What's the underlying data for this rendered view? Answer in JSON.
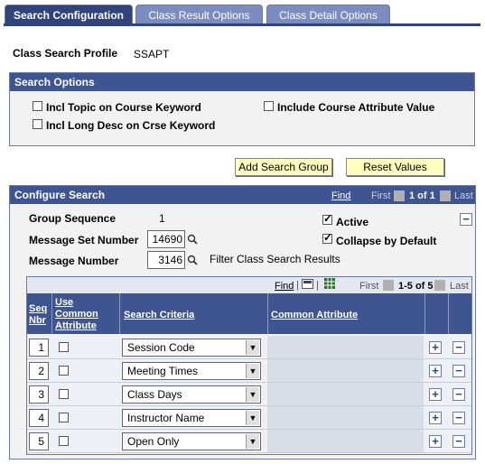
{
  "tabs": [
    {
      "label": "Search Configuration"
    },
    {
      "label": "Class Result Options"
    },
    {
      "label": "Class Detail Options"
    }
  ],
  "profile": {
    "label": "Class Search Profile",
    "value": "SSAPT"
  },
  "search_options": {
    "title": "Search Options",
    "incl_topic": {
      "label": "Incl Topic on Course Keyword",
      "checked": false
    },
    "incl_long_desc": {
      "label": "Incl Long Desc on Crse Keyword",
      "checked": false
    },
    "include_attr": {
      "label": "Include Course Attribute Value",
      "checked": false
    }
  },
  "buttons": {
    "add_search_group": "Add Search Group",
    "reset_values": "Reset Values"
  },
  "configure": {
    "title": "Configure Search",
    "find": "Find",
    "first": "First",
    "range": "1 of 1",
    "last": "Last",
    "group_sequence_label": "Group Sequence",
    "group_sequence_value": "1",
    "message_set_label": "Message Set Number",
    "message_set_value": "14690",
    "message_number_label": "Message Number",
    "message_number_value": "3146",
    "message_text": "Filter Class Search Results",
    "active": {
      "label": "Active",
      "checked": true
    },
    "collapse": {
      "label": "Collapse by Default",
      "checked": true
    }
  },
  "grid": {
    "find": "Find",
    "first": "First",
    "range": "1-5 of 5",
    "last": "Last",
    "headers": {
      "seq": "Seq Nbr",
      "use_common": "Use Common Attribute",
      "criteria": "Search Criteria",
      "common_attr": "Common Attribute"
    },
    "rows": [
      {
        "seq": "1",
        "criteria": "Session Code"
      },
      {
        "seq": "2",
        "criteria": "Meeting Times"
      },
      {
        "seq": "3",
        "criteria": "Class Days"
      },
      {
        "seq": "4",
        "criteria": "Instructor Name"
      },
      {
        "seq": "5",
        "criteria": "Open Only"
      }
    ]
  },
  "colors": {
    "tab_active": "#31437c",
    "tab_inactive": "#7b8dc0",
    "header": "#3e5591",
    "button": "#ffffc0"
  }
}
